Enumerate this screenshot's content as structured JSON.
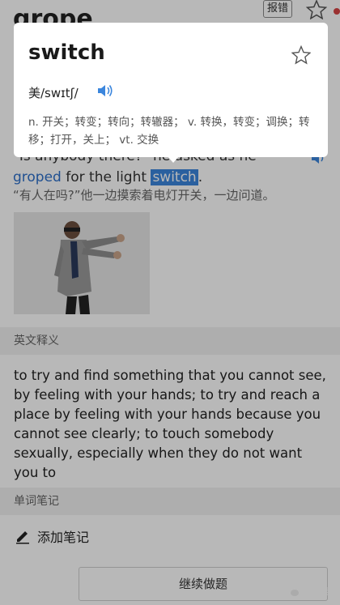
{
  "header": {
    "word": "grope",
    "report_label": "报错"
  },
  "example": {
    "line1": "\"Is anybody there?\" he asked as he",
    "line2_blue": "groped",
    "line2_mid": " for the light ",
    "line2_sel": "switch",
    "line2_end": ".",
    "translation": "“有人在吗?”他一边摸索着电灯开关，一边问道。"
  },
  "sections": {
    "english_def_title": "英文释义",
    "english_def": "to try and find something that you cannot see, by feeling with your hands; to try and reach a place by feeling with your hands because you cannot see clearly; to touch somebody sexually, especially when they do not want you to",
    "notes_title": "单词笔记",
    "add_note_label": "添加笔记"
  },
  "footer": {
    "continue_label": "继续做题",
    "watermark": "树小姐"
  },
  "popup": {
    "word": "switch",
    "phonetic": "美/swɪtʃ/",
    "definitions": "n. 开关；转变；转向；转辙器；  v. 转换，转变；调换；转移；打开，关上；  vt. 交换"
  },
  "colors": {
    "accent_blue": "#2d6fc9",
    "selection_blue": "#3b86dd",
    "overlay": "rgba(0,0,0,0.28)"
  },
  "icons": [
    "star-icon",
    "speaker-icon",
    "pencil-icon",
    "wechat-icon"
  ]
}
